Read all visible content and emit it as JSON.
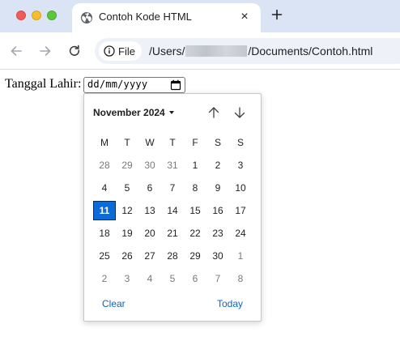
{
  "browser": {
    "tab_title": "Contoh Kode HTML",
    "tab_close": "×",
    "address_chip": "File",
    "url_prefix": "/Users/",
    "url_suffix": "/Documents/Contoh.html"
  },
  "page": {
    "field_label": "Tanggal Lahir:",
    "date_placeholder": "dd/mm/yyyy"
  },
  "picker": {
    "month_label": "November 2024",
    "weekdays": [
      "M",
      "T",
      "W",
      "T",
      "F",
      "S",
      "S"
    ],
    "weeks": [
      [
        {
          "d": "28",
          "m": true
        },
        {
          "d": "29",
          "m": true
        },
        {
          "d": "30",
          "m": true
        },
        {
          "d": "31",
          "m": true
        },
        {
          "d": "1"
        },
        {
          "d": "2"
        },
        {
          "d": "3"
        }
      ],
      [
        {
          "d": "4"
        },
        {
          "d": "5"
        },
        {
          "d": "6"
        },
        {
          "d": "7"
        },
        {
          "d": "8"
        },
        {
          "d": "9"
        },
        {
          "d": "10"
        }
      ],
      [
        {
          "d": "11",
          "s": true
        },
        {
          "d": "12"
        },
        {
          "d": "13"
        },
        {
          "d": "14"
        },
        {
          "d": "15"
        },
        {
          "d": "16"
        },
        {
          "d": "17"
        }
      ],
      [
        {
          "d": "18"
        },
        {
          "d": "19"
        },
        {
          "d": "20"
        },
        {
          "d": "21"
        },
        {
          "d": "22"
        },
        {
          "d": "23"
        },
        {
          "d": "24"
        }
      ],
      [
        {
          "d": "25"
        },
        {
          "d": "26"
        },
        {
          "d": "27"
        },
        {
          "d": "28"
        },
        {
          "d": "29"
        },
        {
          "d": "30"
        },
        {
          "d": "1",
          "m": true
        }
      ],
      [
        {
          "d": "2",
          "m": true
        },
        {
          "d": "3",
          "m": true
        },
        {
          "d": "4",
          "m": true
        },
        {
          "d": "5",
          "m": true
        },
        {
          "d": "6",
          "m": true
        },
        {
          "d": "7",
          "m": true
        },
        {
          "d": "8",
          "m": true
        }
      ]
    ],
    "clear_label": "Clear",
    "today_label": "Today"
  },
  "colors": {
    "tabstrip": "#dbe4f4",
    "selected_day": "#0b6cd9",
    "link": "#0a64c8"
  }
}
